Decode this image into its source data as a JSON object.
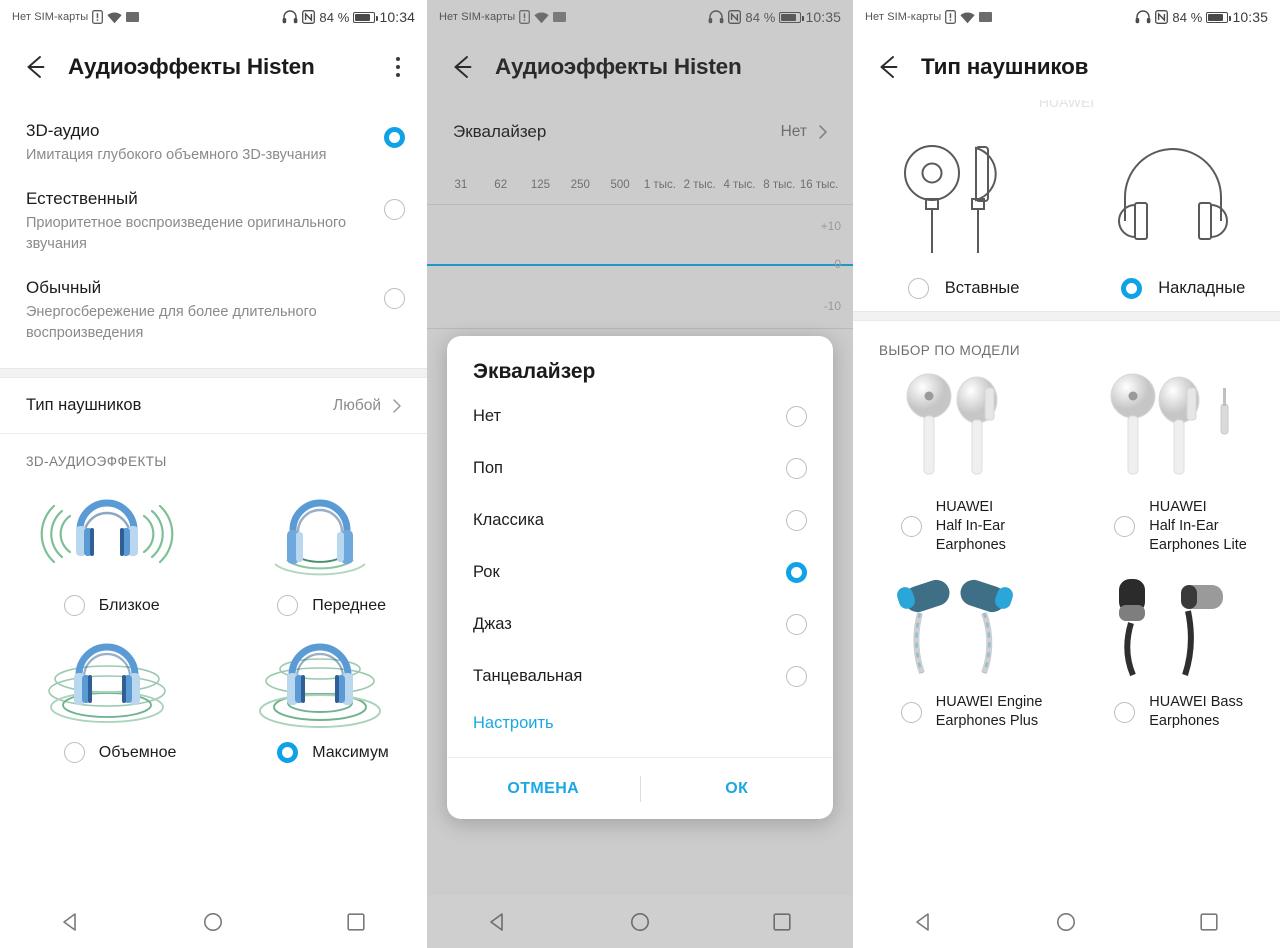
{
  "screens": [
    {
      "status": {
        "sim": "Нет SIM-карты",
        "battery": "84 %",
        "time": "10:34",
        "icons": [
          "sim-alert-icon",
          "wifi-icon",
          "sms-icon",
          "headset-icon",
          "nfc-icon",
          "battery-icon"
        ]
      },
      "appbar": {
        "title": "Аудиоэффекты Histen",
        "back": "back-arrow-icon",
        "menu": "overflow-menu-icon"
      },
      "modes": [
        {
          "title": "3D-аудио",
          "sub": "Имитация глубокого объемного 3D-звучания",
          "selected": true
        },
        {
          "title": "Естественный",
          "sub": "Приоритетное воспроизведение оригинального звучания",
          "selected": false
        },
        {
          "title": "Обычный",
          "sub": "Энергосбережение для более длительного воспроизведения",
          "selected": false
        }
      ],
      "headphone_row": {
        "label": "Тип наушников",
        "value": "Любой"
      },
      "section_header": "3D-АУДИОЭФФЕКТЫ",
      "effects": [
        {
          "label": "Близкое",
          "selected": false,
          "art": "headphones-near-icon"
        },
        {
          "label": "Переднее",
          "selected": false,
          "art": "headphones-front-icon"
        },
        {
          "label": "Объемное",
          "selected": false,
          "art": "headphones-surround-icon"
        },
        {
          "label": "Максимум",
          "selected": true,
          "art": "headphones-max-icon"
        }
      ]
    },
    {
      "status": {
        "sim": "Нет SIM-карты",
        "battery": "84 %",
        "time": "10:35"
      },
      "appbar": {
        "title": "Аудиоэффекты Histen"
      },
      "eq_row": {
        "label": "Эквалайзер",
        "value": "Нет"
      },
      "freq_labels": [
        "31",
        "62",
        "125",
        "250",
        "500",
        "1 тыс.",
        "2 тыс.",
        "4 тыс.",
        "8 тыс.",
        "16 тыс."
      ],
      "graph_labels": {
        "high": "+10",
        "zero": "0",
        "low": "-10"
      },
      "dialog": {
        "title": "Эквалайзер",
        "options": [
          {
            "label": "Нет",
            "selected": false
          },
          {
            "label": "Поп",
            "selected": false
          },
          {
            "label": "Классика",
            "selected": false
          },
          {
            "label": "Рок",
            "selected": true
          },
          {
            "label": "Джаз",
            "selected": false
          },
          {
            "label": "Танцевальная",
            "selected": false
          }
        ],
        "custom_link": "Настроить",
        "cancel": "ОТМЕНА",
        "ok": "ОК"
      }
    },
    {
      "status": {
        "sim": "Нет SIM-карты",
        "battery": "84 %",
        "time": "10:35"
      },
      "appbar": {
        "title": "Тип наушников"
      },
      "types": [
        {
          "label": "Вставные",
          "selected": false,
          "art": "earbuds-icon"
        },
        {
          "label": "Накладные",
          "selected": true,
          "art": "over-ear-headphones-icon"
        }
      ],
      "models_header": "ВЫБОР ПО МОДЕЛИ",
      "models": [
        {
          "name": "HUAWEI\nHalf In-Ear\nEarphones",
          "selected": false,
          "art": "huawei-half-in-ear-photo"
        },
        {
          "name": "HUAWEI\nHalf In-Ear\nEarphones Lite",
          "selected": false,
          "art": "huawei-half-in-ear-lite-photo"
        },
        {
          "name": "HUAWEI Engine\nEarphones Plus",
          "selected": false,
          "art": "huawei-engine-plus-photo"
        },
        {
          "name": "HUAWEI Bass\nEarphones",
          "selected": false,
          "art": "huawei-bass-photo"
        }
      ]
    }
  ],
  "navbar": {
    "back": "triangle-back-icon",
    "home": "circle-home-icon",
    "recents": "square-recents-icon"
  },
  "colors": {
    "accent": "#0FA2E6",
    "link": "#19a8e4",
    "scrim": "#cccccc",
    "art_blue": "#4E8FD0",
    "art_green": "#5CA87E"
  }
}
